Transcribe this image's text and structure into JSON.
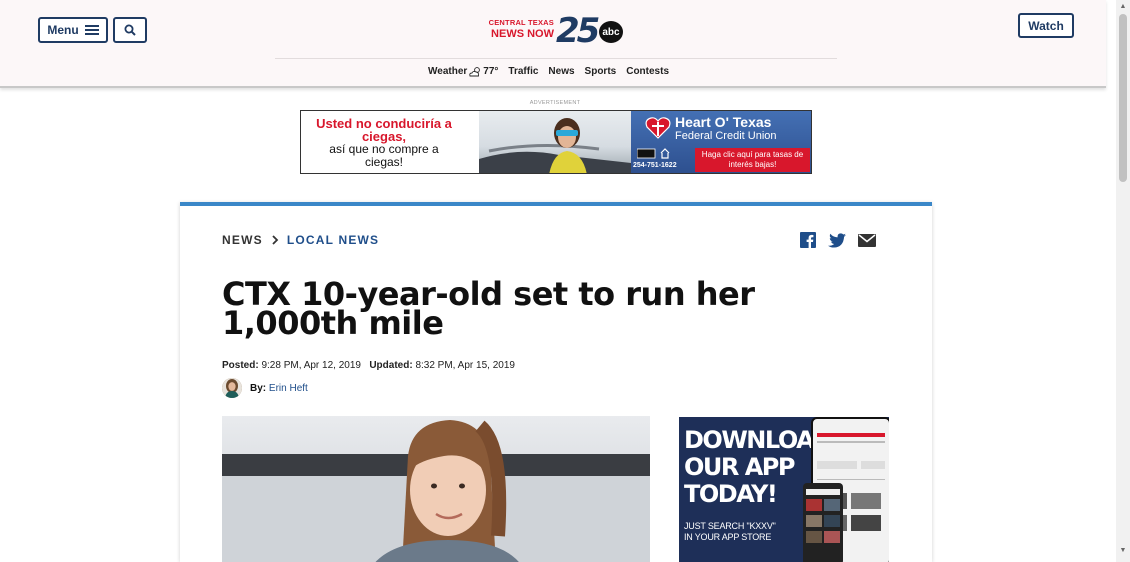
{
  "header": {
    "menu_label": "Menu",
    "watch_label": "Watch",
    "logo": {
      "line1": "CENTRAL TEXAS",
      "line2": "NEWS NOW",
      "number": "25",
      "network": "abc"
    },
    "nav": {
      "weather_label": "Weather",
      "temperature": "77°",
      "items": [
        "Traffic",
        "News",
        "Sports",
        "Contests"
      ]
    }
  },
  "ad": {
    "label": "ADVERTISEMENT",
    "left_red": "Usted no conduciría a ciegas,",
    "left_black": "así que no compre a ciegas!",
    "brand": "Heart O' Texas",
    "brand_sub": "Federal Credit Union",
    "phone": "254-751-1622",
    "cta": "Haga clic aquí para tasas de interés bajas!"
  },
  "article": {
    "breadcrumb": {
      "section": "NEWS",
      "subsection": "LOCAL NEWS"
    },
    "title": "CTX 10-year-old set to run her 1,000th mile",
    "posted_label": "Posted:",
    "posted_value": "9:28 PM, Apr 12, 2019",
    "updated_label": "Updated:",
    "updated_value": "8:32 PM, Apr 15, 2019",
    "by_label": "By:",
    "author": "Erin Heft"
  },
  "app_ad": {
    "headline_lines": [
      "DOWNLOAD",
      "OUR APP",
      "TODAY!"
    ],
    "sub_lines": [
      "JUST SEARCH \"KXXV\"",
      "IN YOUR APP STORE"
    ]
  },
  "colors": {
    "brand_navy": "#1f3b63",
    "brand_red": "#d8172c",
    "accent_blue": "#3a87c8",
    "link_blue": "#1f4e8a"
  }
}
